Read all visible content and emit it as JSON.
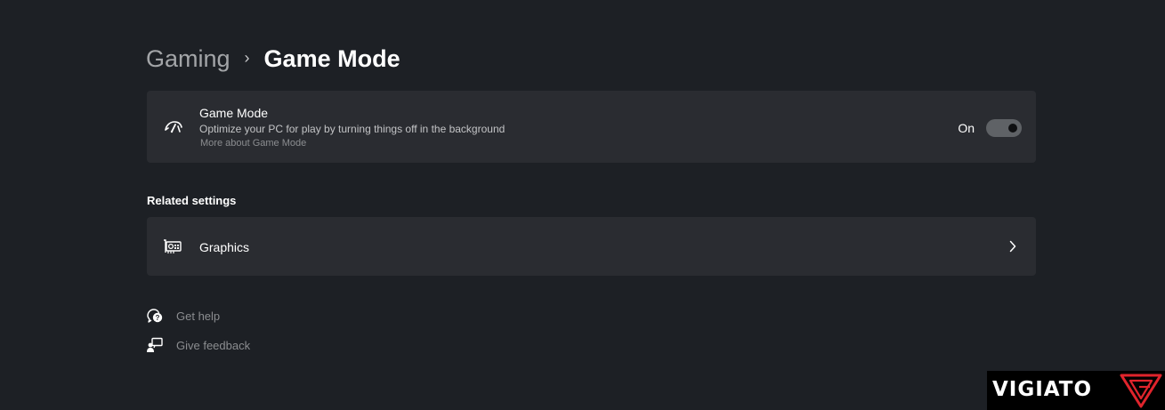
{
  "breadcrumb": {
    "parent": "Gaming",
    "separator": "›",
    "current": "Game Mode"
  },
  "game_mode_card": {
    "icon": "speedometer-gamepad-icon",
    "title": "Game Mode",
    "description": "Optimize your PC for play by turning things off in the background",
    "link": "More about Game Mode",
    "toggle_label": "On",
    "toggle_on": true
  },
  "related_settings": {
    "title": "Related settings",
    "items": [
      {
        "label": "Graphics",
        "icon": "graphics-card-icon",
        "chevron": "chevron-right-icon"
      }
    ]
  },
  "help_links": [
    {
      "label": "Get help",
      "icon": "help-chat-icon"
    },
    {
      "label": "Give feedback",
      "icon": "feedback-icon"
    }
  ],
  "watermark": {
    "text": "VIGIATO",
    "logo": "vigiato-logo",
    "brand_color": "#e0242c"
  },
  "colors": {
    "background": "#1d2025",
    "card": "#2a2c31",
    "toggle_track": "#5f6266"
  }
}
